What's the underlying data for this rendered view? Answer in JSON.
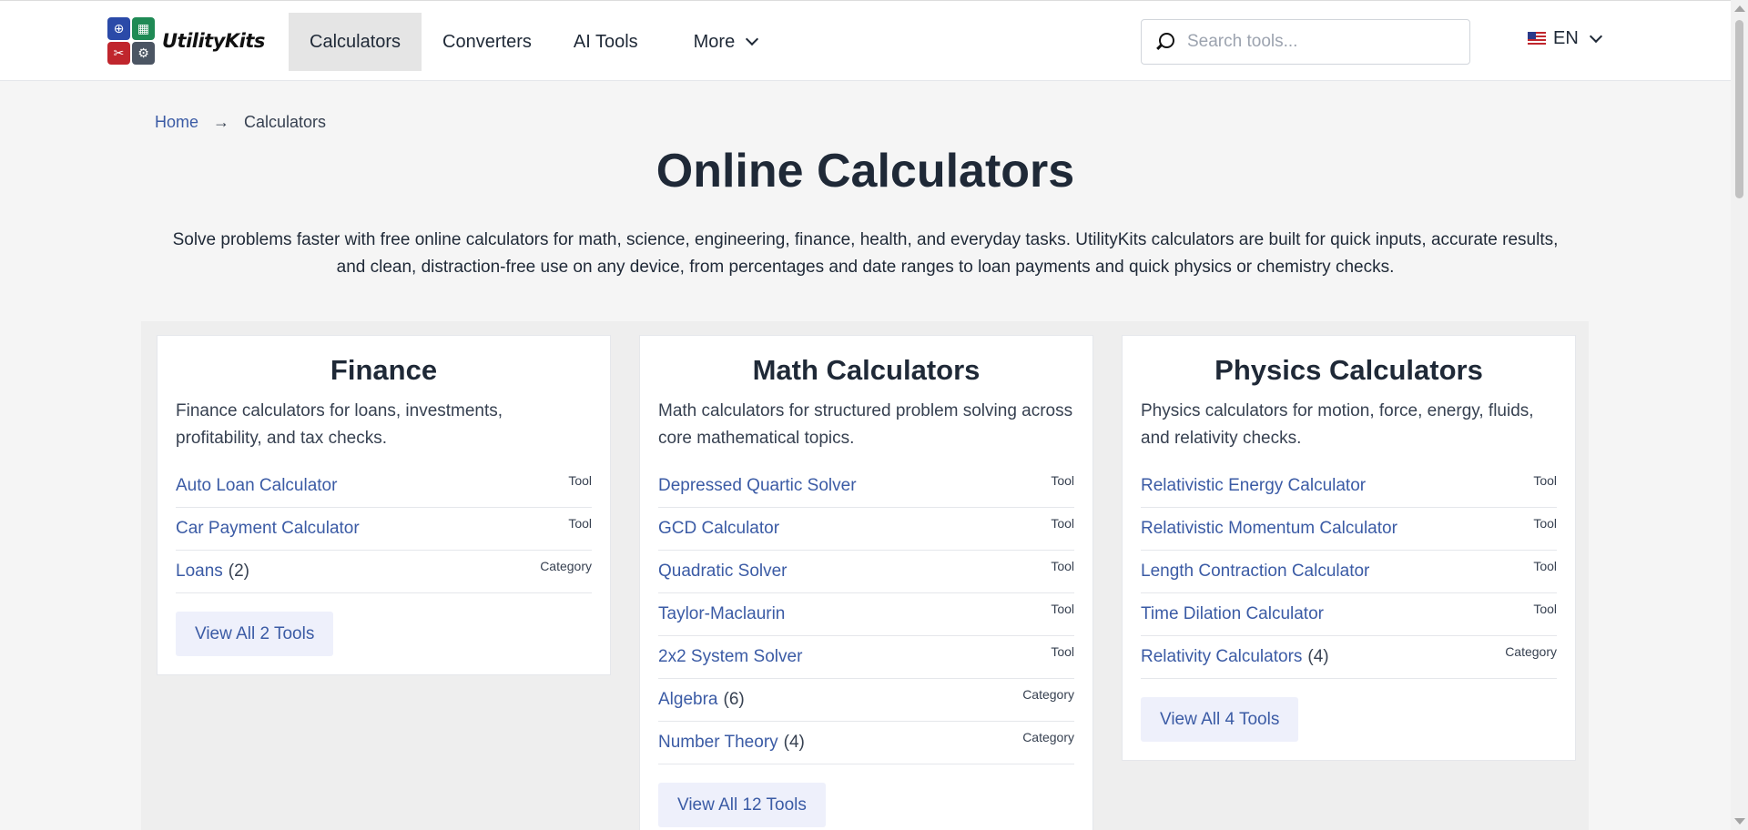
{
  "header": {
    "brand": "UtilityKits",
    "logo_glyphs": [
      "⊕",
      "▦",
      "✂",
      "⚙"
    ],
    "nav": [
      {
        "label": "Calculators"
      },
      {
        "label": "Converters"
      },
      {
        "label": "AI Tools"
      },
      {
        "label": "More"
      }
    ],
    "search_placeholder": "Search tools...",
    "lang": "EN"
  },
  "breadcrumb": {
    "home": "Home",
    "sep": "→",
    "current": "Calculators"
  },
  "page": {
    "title": "Online Calculators",
    "intro": "Solve problems faster with free online calculators for math, science, engineering, finance, health, and everyday tasks. UtilityKits calculators are built for quick inputs, accurate results, and clean, distraction-free use on any device, from percentages and date ranges to loan payments and quick physics or chemistry checks."
  },
  "cards": [
    {
      "title": "Finance",
      "desc": "Finance calculators for loans, investments, profitability, and tax checks.",
      "items": [
        {
          "label": "Auto Loan Calculator",
          "count": "",
          "tag": "Tool"
        },
        {
          "label": "Car Payment Calculator",
          "count": "",
          "tag": "Tool"
        },
        {
          "label": "Loans",
          "count": "(2)",
          "tag": "Category"
        }
      ],
      "button": "View All 2 Tools"
    },
    {
      "title": "Math Calculators",
      "desc": "Math calculators for structured problem solving across core mathematical topics.",
      "items": [
        {
          "label": "Depressed Quartic Solver",
          "count": "",
          "tag": "Tool"
        },
        {
          "label": "GCD Calculator",
          "count": "",
          "tag": "Tool"
        },
        {
          "label": "Quadratic Solver",
          "count": "",
          "tag": "Tool"
        },
        {
          "label": "Taylor-Maclaurin",
          "count": "",
          "tag": "Tool"
        },
        {
          "label": "2x2 System Solver",
          "count": "",
          "tag": "Tool"
        },
        {
          "label": "Algebra",
          "count": "(6)",
          "tag": "Category"
        },
        {
          "label": "Number Theory",
          "count": "(4)",
          "tag": "Category"
        }
      ],
      "button": "View All 12 Tools"
    },
    {
      "title": "Physics Calculators",
      "desc": "Physics calculators for motion, force, energy, fluids, and relativity checks.",
      "items": [
        {
          "label": "Relativistic Energy Calculator",
          "count": "",
          "tag": "Tool"
        },
        {
          "label": "Relativistic Momentum Calculator",
          "count": "",
          "tag": "Tool"
        },
        {
          "label": "Length Contraction Calculator",
          "count": "",
          "tag": "Tool"
        },
        {
          "label": "Time Dilation Calculator",
          "count": "",
          "tag": "Tool"
        },
        {
          "label": "Relativity Calculators",
          "count": "(4)",
          "tag": "Category"
        }
      ],
      "button": "View All 4 Tools"
    }
  ]
}
